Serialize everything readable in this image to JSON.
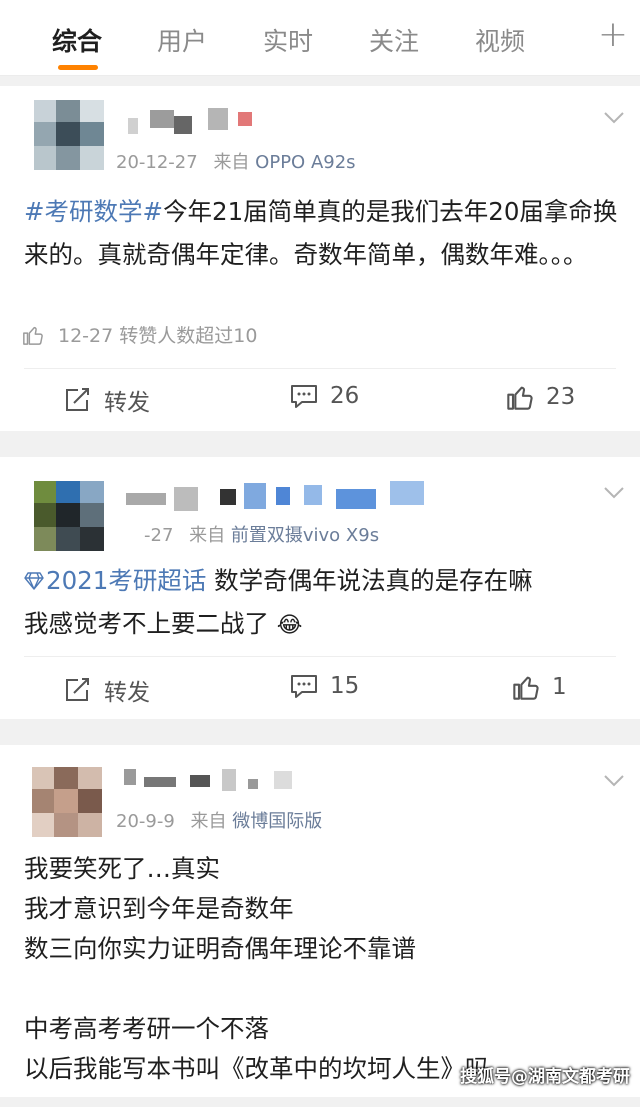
{
  "tabs": [
    {
      "label": "综合",
      "active": true
    },
    {
      "label": "用户",
      "active": false
    },
    {
      "label": "实时",
      "active": false
    },
    {
      "label": "关注",
      "active": false
    },
    {
      "label": "视频",
      "active": false
    }
  ],
  "add_tab_symbol": "+",
  "posts": [
    {
      "time": "20-12-27",
      "source_prefix": "来自",
      "source": "OPPO A92s",
      "content_topic": "#考研数学#",
      "content": "今年21届简单真的是我们去年20届拿命换来的。真就奇偶年定律。奇数年简单，偶数年难。。。",
      "likes_info": "12-27 转赞人数超过10",
      "repost_label": "转发",
      "comment_count": "26",
      "like_count": "23"
    },
    {
      "time": "-27",
      "source_prefix": "来自",
      "source": "前置双摄vivo X9s",
      "content_topic": "2021考研超话",
      "content": " 数学奇偶年说法真的是存在嘛\n我感觉考不上要二战了",
      "emoji": "😂",
      "repost_label": "转发",
      "comment_count": "15",
      "like_count": "1"
    },
    {
      "time": "20-9-9",
      "source_prefix": "来自",
      "source": "微博国际版",
      "content": "我要笑死了…真实\n我才意识到今年是奇数年\n数三向你实力证明奇偶年理论不靠谱\n\n中考高考考研一个不落\n以后我能写本书叫《改革中的坎坷人生》吗"
    }
  ],
  "watermark": "搜狐号@湖南文都考研",
  "colors": {
    "accent": "#ff8200",
    "topic": "#4d79b5",
    "source": "#6b7d99"
  }
}
